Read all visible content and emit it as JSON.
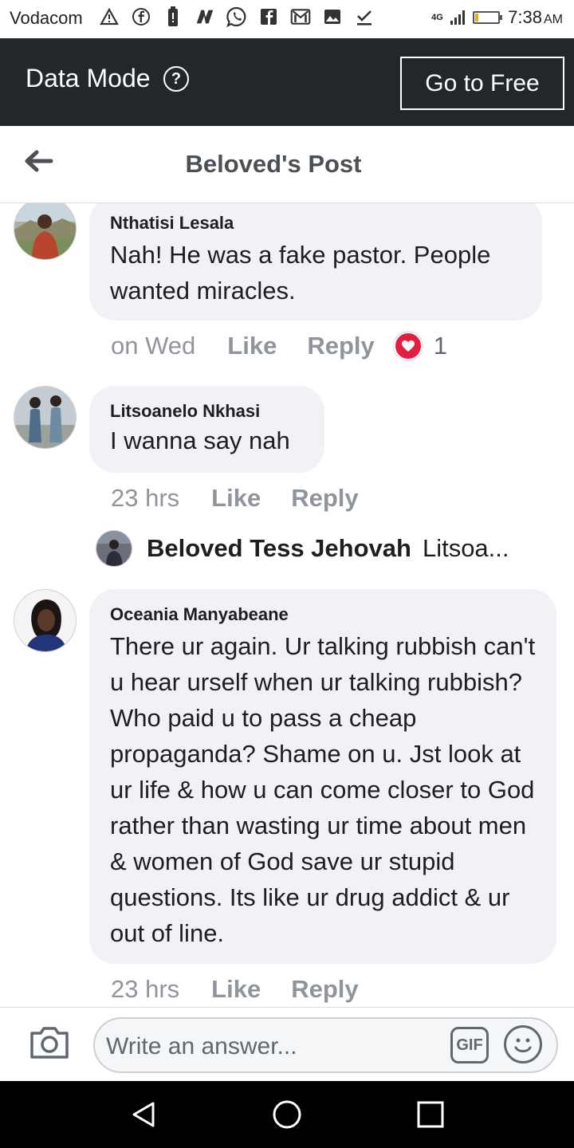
{
  "status_bar": {
    "carrier": "Vodacom",
    "network": "4G",
    "time": "7:38",
    "ampm": "AM",
    "battery_level": 0.15,
    "icons": [
      "warning-icon",
      "facebook-icon",
      "battery-saver-icon",
      "nfc-icon",
      "whatsapp-icon",
      "facebook-lite-icon",
      "gmail-icon",
      "image-icon",
      "download-done-icon"
    ]
  },
  "data_mode": {
    "label": "Data Mode",
    "help_glyph": "?",
    "button": "Go to Free"
  },
  "header": {
    "title": "Beloved's Post"
  },
  "comments": [
    {
      "author": "Nthatisi Lesala",
      "text": "Nah! He was a fake pastor. People wanted miracles.",
      "time": "on Wed",
      "like": "Like",
      "reply": "Reply",
      "reaction_count": "1"
    },
    {
      "author": "Litsoanelo Nkhasi",
      "text": "I wanna say nah",
      "time": "23 hrs",
      "like": "Like",
      "reply": "Reply",
      "reply_preview": {
        "author": "Beloved Tess Jehovah",
        "snippet": "Litsoa..."
      }
    },
    {
      "author": "Oceania Manyabeane",
      "text": "There ur again. Ur talking rubbish can't u hear urself when ur talking rubbish? Who paid u to pass a cheap propaganda? Shame on u. Jst look at ur life & how u can come closer to God rather than wasting ur time about men & women of God save ur stupid questions. Its like ur drug addict & ur out of line.",
      "time": "23 hrs",
      "like": "Like",
      "reply": "Reply"
    }
  ],
  "composer": {
    "placeholder": "Write an answer...",
    "gif_label": "GIF"
  },
  "colors": {
    "data_mode_bg": "#23262b",
    "bubble_bg": "#f0f2f5",
    "heart": "#e41e3f",
    "meta_text": "#90949c"
  }
}
